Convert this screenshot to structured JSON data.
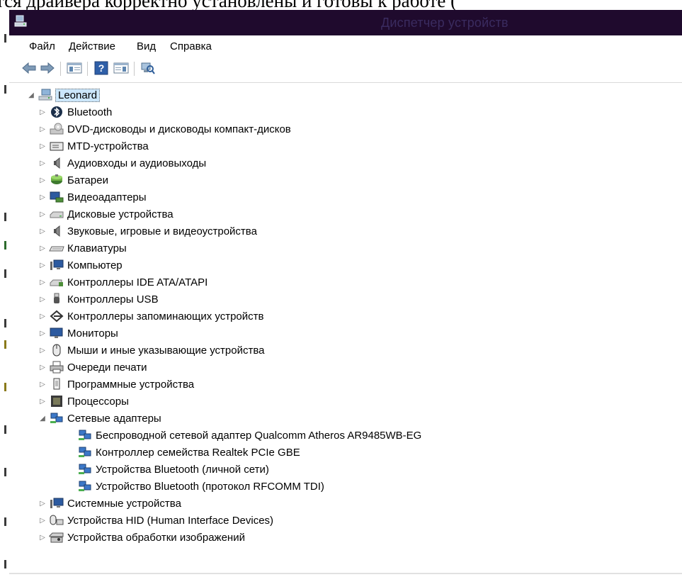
{
  "background_text": "тся драйвера корректно установлены и готовы к работе (",
  "window": {
    "title": "Диспетчер устройств",
    "title_color": "#1f0a2d",
    "selection_color": "#cbe6fb"
  },
  "menu": [
    "Файл",
    "Действие",
    "Вид",
    "Справка"
  ],
  "toolbar": [
    {
      "icon": "back-arrow-icon"
    },
    {
      "icon": "forward-arrow-icon"
    },
    {
      "icon": "show-hide-console-tree-icon"
    },
    {
      "icon": "help-icon"
    },
    {
      "icon": "show-hide-action-pane-icon"
    },
    {
      "icon": "scan-hardware-icon"
    }
  ],
  "tree": {
    "root": {
      "label": "Leonard",
      "icon": "computer-icon",
      "expanded": true,
      "selected": true
    },
    "items": [
      {
        "label": "Bluetooth",
        "icon": "bluetooth-icon",
        "expanded": false
      },
      {
        "label": "DVD-дисководы и дисководы компакт-дисков",
        "icon": "dvd-drive-icon",
        "expanded": false
      },
      {
        "label": "MTD-устройства",
        "icon": "mtd-device-icon",
        "expanded": false
      },
      {
        "label": "Аудиовходы и аудиовыходы",
        "icon": "speaker-icon",
        "expanded": false
      },
      {
        "label": "Батареи",
        "icon": "battery-icon",
        "expanded": false
      },
      {
        "label": "Видеоадаптеры",
        "icon": "display-adapter-icon",
        "expanded": false
      },
      {
        "label": "Дисковые устройства",
        "icon": "disk-drive-icon",
        "expanded": false
      },
      {
        "label": "Звуковые, игровые и видеоустройства",
        "icon": "sound-icon",
        "expanded": false
      },
      {
        "label": "Клавиатуры",
        "icon": "keyboard-icon",
        "expanded": false
      },
      {
        "label": "Компьютер",
        "icon": "computer-monitor-icon",
        "expanded": false
      },
      {
        "label": "Контроллеры IDE ATA/ATAPI",
        "icon": "ide-controller-icon",
        "expanded": false
      },
      {
        "label": "Контроллеры USB",
        "icon": "usb-icon",
        "expanded": false
      },
      {
        "label": "Контроллеры запоминающих устройств",
        "icon": "storage-controller-icon",
        "expanded": false
      },
      {
        "label": "Мониторы",
        "icon": "monitor-icon",
        "expanded": false
      },
      {
        "label": "Мыши и иные указывающие устройства",
        "icon": "mouse-icon",
        "expanded": false
      },
      {
        "label": "Очереди печати",
        "icon": "printer-icon",
        "expanded": false
      },
      {
        "label": "Программные устройства",
        "icon": "software-device-icon",
        "expanded": false
      },
      {
        "label": "Процессоры",
        "icon": "processor-icon",
        "expanded": false
      },
      {
        "label": "Сетевые адаптеры",
        "icon": "network-adapter-icon",
        "expanded": true,
        "children": [
          {
            "label": "Беспроводной сетевой адаптер Qualcomm Atheros AR9485WB-EG",
            "icon": "network-adapter-icon"
          },
          {
            "label": "Контроллер семейства Realtek PCIe GBE",
            "icon": "network-adapter-icon"
          },
          {
            "label": "Устройства Bluetooth (личной сети)",
            "icon": "network-adapter-icon"
          },
          {
            "label": "Устройство Bluetooth (протокол RFCOMM TDI)",
            "icon": "network-adapter-icon"
          }
        ]
      },
      {
        "label": "Системные устройства",
        "icon": "system-device-icon",
        "expanded": false
      },
      {
        "label": "Устройства HID (Human Interface Devices)",
        "icon": "hid-icon",
        "expanded": false
      },
      {
        "label": "Устройства обработки изображений",
        "icon": "imaging-device-icon",
        "expanded": false
      }
    ]
  }
}
